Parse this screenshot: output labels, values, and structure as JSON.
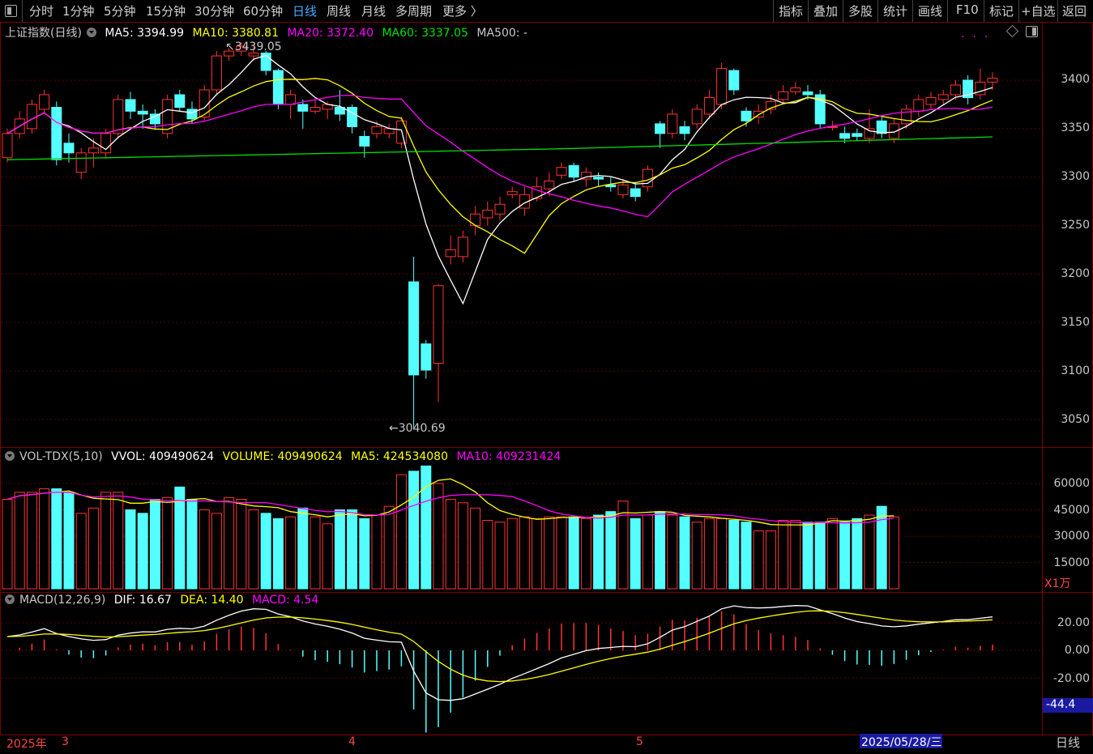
{
  "toolbar": {
    "left": [
      "分时",
      "1分钟",
      "5分钟",
      "15分钟",
      "30分钟",
      "60分钟",
      "日线",
      "周线",
      "月线",
      "多周期",
      "更多 〉"
    ],
    "active_index": 6,
    "right": [
      "指标",
      "叠加",
      "多股",
      "统计",
      "画线",
      "F10",
      "标记",
      "+自选",
      "返回"
    ]
  },
  "main_legend": {
    "title": "上证指数(日线)",
    "ma5": "MA5: 3394.99",
    "ma10": "MA10: 3380.81",
    "ma20": "MA20: 3372.40",
    "ma60": "MA60: 3337.05",
    "ma500": "MA500: -"
  },
  "annotations": {
    "high": "3439.05",
    "low": "3040.69"
  },
  "price_axis": [
    "3400",
    "3350",
    "3300",
    "3250",
    "3200",
    "3150",
    "3100",
    "3050"
  ],
  "vol_legend": {
    "title": "VOL-TDX(5,10)",
    "vvol": "VVOL: 409490624",
    "volume": "VOLUME: 409490624",
    "ma5": "MA5: 424534080",
    "ma10": "MA10: 409231424"
  },
  "vol_axis": [
    "60000",
    "45000",
    "30000",
    "15000"
  ],
  "vol_unit": "X1万",
  "macd_legend": {
    "title": "MACD(12,26,9)",
    "dif": "DIF: 16.67",
    "dea": "DEA: 14.40",
    "macd": "MACD: 4.54"
  },
  "macd_axis": [
    "20.00",
    "0.00",
    "-20.00"
  ],
  "macd_cursor": "-44.4",
  "dates": {
    "year": "2025年",
    "m3": "3",
    "m4": "4",
    "m5": "5",
    "selected": "2025/05/28/三"
  },
  "period": "日线",
  "colors": {
    "up": "#ff3232",
    "down": "#54ffff",
    "ma5": "#ffffff",
    "ma10": "#ffff00",
    "ma20": "#ff00ff",
    "ma60": "#00e000",
    "grid": "#5a0000"
  },
  "candles": [
    [
      3320,
      3345,
      3315,
      3350
    ],
    [
      3345,
      3360,
      3340,
      3368
    ],
    [
      3350,
      3375,
      3345,
      3380
    ],
    [
      3370,
      3385,
      3365,
      3390
    ],
    [
      3372,
      3318,
      3312,
      3378
    ],
    [
      3335,
      3325,
      3315,
      3345
    ],
    [
      3305,
      3325,
      3298,
      3330
    ],
    [
      3325,
      3330,
      3310,
      3340
    ],
    [
      3325,
      3345,
      3320,
      3350
    ],
    [
      3345,
      3380,
      3340,
      3385
    ],
    [
      3380,
      3368,
      3360,
      3388
    ],
    [
      3368,
      3365,
      3350,
      3375
    ],
    [
      3365,
      3355,
      3350,
      3370
    ],
    [
      3345,
      3380,
      3340,
      3385
    ],
    [
      3385,
      3372,
      3368,
      3390
    ],
    [
      3370,
      3360,
      3355,
      3378
    ],
    [
      3362,
      3390,
      3358,
      3395
    ],
    [
      3390,
      3425,
      3385,
      3430
    ],
    [
      3425,
      3430,
      3420,
      3433
    ],
    [
      3430,
      3435,
      3425,
      3439
    ],
    [
      3425,
      3428,
      3420,
      3435
    ],
    [
      3428,
      3410,
      3405,
      3430
    ],
    [
      3410,
      3375,
      3370,
      3412
    ],
    [
      3375,
      3385,
      3360,
      3390
    ],
    [
      3375,
      3368,
      3350,
      3380
    ],
    [
      3368,
      3372,
      3365,
      3380
    ],
    [
      3370,
      3375,
      3360,
      3378
    ],
    [
      3372,
      3365,
      3358,
      3390
    ],
    [
      3372,
      3352,
      3345,
      3375
    ],
    [
      3342,
      3332,
      3320,
      3348
    ],
    [
      3345,
      3352,
      3340,
      3358
    ],
    [
      3345,
      3350,
      3340,
      3355
    ],
    [
      3335,
      3358,
      3330,
      3362
    ],
    [
      3192,
      3096,
      3040,
      3218
    ],
    [
      3128,
      3101,
      3092,
      3132
    ],
    [
      3108,
      3188,
      3068,
      3190
    ],
    [
      3218,
      3225,
      3210,
      3240
    ],
    [
      3218,
      3238,
      3212,
      3245
    ],
    [
      3250,
      3262,
      3240,
      3270
    ],
    [
      3258,
      3266,
      3250,
      3275
    ],
    [
      3262,
      3272,
      3255,
      3280
    ],
    [
      3282,
      3285,
      3278,
      3290
    ],
    [
      3268,
      3282,
      3260,
      3290
    ],
    [
      3278,
      3290,
      3275,
      3300
    ],
    [
      3288,
      3296,
      3280,
      3305
    ],
    [
      3302,
      3310,
      3298,
      3315
    ],
    [
      3312,
      3300,
      3295,
      3315
    ],
    [
      3298,
      3305,
      3290,
      3310
    ],
    [
      3300,
      3298,
      3290,
      3305
    ],
    [
      3292,
      3290,
      3285,
      3300
    ],
    [
      3282,
      3292,
      3278,
      3298
    ],
    [
      3288,
      3280,
      3275,
      3295
    ],
    [
      3290,
      3308,
      3285,
      3312
    ],
    [
      3355,
      3345,
      3330,
      3358
    ],
    [
      3345,
      3365,
      3340,
      3370
    ],
    [
      3352,
      3345,
      3338,
      3358
    ],
    [
      3355,
      3370,
      3350,
      3375
    ],
    [
      3365,
      3382,
      3360,
      3390
    ],
    [
      3375,
      3412,
      3370,
      3418
    ],
    [
      3410,
      3390,
      3385,
      3412
    ],
    [
      3368,
      3358,
      3352,
      3372
    ],
    [
      3362,
      3368,
      3355,
      3375
    ],
    [
      3370,
      3378,
      3365,
      3385
    ],
    [
      3380,
      3388,
      3375,
      3395
    ],
    [
      3388,
      3392,
      3385,
      3398
    ],
    [
      3388,
      3385,
      3380,
      3395
    ],
    [
      3385,
      3355,
      3350,
      3390
    ],
    [
      3352,
      3352,
      3348,
      3358
    ],
    [
      3345,
      3340,
      3335,
      3352
    ],
    [
      3345,
      3342,
      3338,
      3350
    ],
    [
      3340,
      3350,
      3335,
      3370
    ],
    [
      3358,
      3345,
      3340,
      3362
    ],
    [
      3340,
      3355,
      3335,
      3360
    ],
    [
      3355,
      3370,
      3350,
      3375
    ],
    [
      3368,
      3380,
      3362,
      3385
    ],
    [
      3375,
      3382,
      3370,
      3388
    ],
    [
      3380,
      3385,
      3375,
      3390
    ],
    [
      3385,
      3395,
      3380,
      3400
    ],
    [
      3400,
      3382,
      3375,
      3405
    ],
    [
      3385,
      3398,
      3380,
      3412
    ],
    [
      3398,
      3402,
      3390,
      3408
    ]
  ],
  "volumes": [
    51,
    55,
    55,
    57,
    57,
    55,
    43,
    46,
    55,
    55,
    45,
    43,
    51,
    52,
    58,
    51,
    45,
    43,
    52,
    51,
    45,
    43,
    40,
    41,
    46,
    41,
    37,
    45,
    45,
    40,
    42,
    47,
    65,
    67,
    70,
    60,
    51,
    49,
    46,
    39,
    38,
    40,
    41,
    40,
    41,
    41,
    41,
    40,
    42,
    44,
    50,
    40,
    42,
    44,
    42,
    41,
    38,
    40,
    40,
    39,
    38,
    33,
    33,
    39,
    39,
    38,
    38,
    40,
    38,
    40,
    42,
    47,
    41
  ]
}
